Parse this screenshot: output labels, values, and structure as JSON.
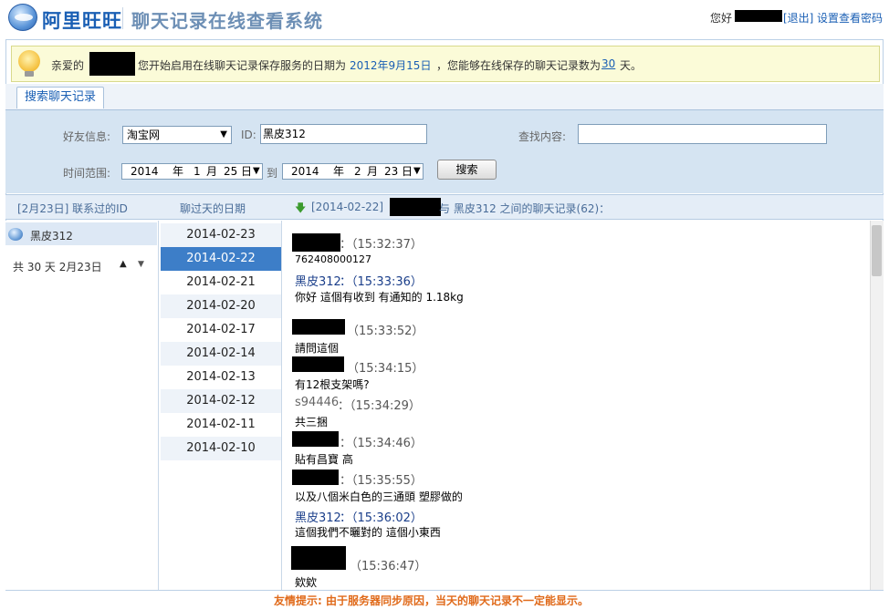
{
  "header": {
    "logo_text": "阿里旺旺",
    "system_title": "聊天记录在线查看系统",
    "greeting": "您好",
    "logout": "[退出]",
    "set_password": "设置查看密码"
  },
  "notice": {
    "prefix": "亲爱的",
    "text_b": "您开始启用在线聊天记录保存服务的日期为",
    "start_date": "2012年9月15日",
    "text_c": "，您能够在线保存的聊天记录数为",
    "days": "30",
    "suffix": "天。"
  },
  "tabs": {
    "search": "搜索聊天记录"
  },
  "search": {
    "friend_label": "好友信息:",
    "friend_select": "淘宝网",
    "id_label": "ID:",
    "id_value": "黑皮312",
    "content_label": "查找内容:",
    "content_value": "",
    "range_label": "时间范围:",
    "from": {
      "year": "2014",
      "y": "年",
      "month": "1",
      "m": "月",
      "day": "25",
      "d": "日"
    },
    "to_label": "到",
    "to": {
      "year": "2014",
      "y": "年",
      "month": "2",
      "m": "月",
      "day": "23",
      "d": "日"
    },
    "button": "搜索"
  },
  "columns": {
    "contacted": "[2月23日] 联系过的ID",
    "dates": "聊过天的日期",
    "chat_prefix": "[2014-02-22]",
    "chat_suffix": "与 黑皮312 之间的聊天记录(62)："
  },
  "contacts": {
    "name": "黑皮312",
    "total": "共 30 天 2月23日"
  },
  "dates": [
    "2014-02-23",
    "2014-02-22",
    "2014-02-21",
    "2014-02-20",
    "2014-02-17",
    "2014-02-14",
    "2014-02-13",
    "2014-02-12",
    "2014-02-11",
    "2014-02-10"
  ],
  "messages": [
    {
      "sender": "",
      "time": "：（15:32:37）",
      "text": "762408000127"
    },
    {
      "sender": "黑皮312",
      "time": "：（15:33:36）",
      "text": "你好 這個有收到 有通知的 1.18kg"
    },
    {
      "sender": "",
      "time": "（15:33:52）",
      "text": "請問這個"
    },
    {
      "sender": "",
      "time": "（15:34:15）",
      "text": "有12根支架嗎?"
    },
    {
      "sender": "s94446",
      "time": "：（15:34:29）",
      "text": "共三捆"
    },
    {
      "sender": "",
      "time": "：（15:34:46）",
      "text": "貼有昌寶 高"
    },
    {
      "sender": "",
      "time": "：（15:35:55）",
      "text": "以及八個米白色的三通頭   塑膠做的"
    },
    {
      "sender": "黑皮312",
      "time": "：（15:36:02）",
      "text": "這個我們不曬對的 這個小東西"
    },
    {
      "sender": "",
      "time": "（15:36:47）",
      "text": "欸欸"
    }
  ],
  "footer": {
    "tip": "友情提示: 由于服务器同步原因，当天的聊天记录不一定能显示。"
  }
}
